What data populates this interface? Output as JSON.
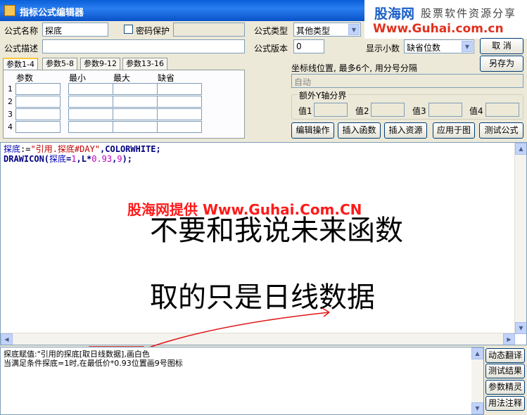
{
  "window": {
    "title": "指标公式编辑器"
  },
  "watermark": {
    "brand": "股海网",
    "tagline": "股票软件资源分享",
    "url": "Www.Guhai.com.cn"
  },
  "form": {
    "name_label": "公式名称",
    "name_value": "探底",
    "password_label": "密码保护",
    "type_label": "公式类型",
    "type_value": "其他类型",
    "desc_label": "公式描述",
    "version_label": "公式版本",
    "version_value": "0",
    "decimals_label": "显示小数",
    "decimals_value": "缺省位数"
  },
  "buttons": {
    "cancel": "取  消",
    "save_as": "另存为",
    "edit_ops": "编辑操作",
    "insert_func": "插入函数",
    "insert_res": "插入资源",
    "apply_chart": "应用于图",
    "test_formula": "测试公式"
  },
  "param_tabs": [
    "参数1-4",
    "参数5-8",
    "参数9-12",
    "参数13-16"
  ],
  "param_headers": [
    "参数",
    "最小",
    "最大",
    "缺省"
  ],
  "param_rows": [
    "1",
    "2",
    "3",
    "4"
  ],
  "axis": {
    "label": "坐标线位置, 最多6个, 用分号分隔",
    "value": "自动",
    "extra_label": "额外Y轴分界",
    "values": [
      "值1",
      "值2",
      "值3",
      "值4"
    ]
  },
  "code": {
    "line1": {
      "var": "探底",
      "op": ":=",
      "str": "\"引用.探底#DAY\"",
      "rest": ",COLORWHITE;"
    },
    "line2": {
      "fn": "DRAWICON(",
      "var": "探底",
      "eq": "=",
      "one": "1",
      "rest1": ",L*",
      "num": "0.93",
      "comma": ",",
      "nine": "9",
      "end": ");"
    }
  },
  "overlay": {
    "red_text": "股海网提供 Www.Guhai.Com.CN",
    "big_line1": "不要和我说未来函数",
    "big_line2": "取的只是日线数据"
  },
  "description": {
    "line1a": "探底赋值:\"引用的探底",
    "line1b": "[取日线数据]",
    "line1c": ",画白色",
    "line2": "当满足条件探底=1时,在最低价*0.93位置画9号图标"
  },
  "side_buttons": [
    "动态翻译",
    "测试结果",
    "参数精灵",
    "用法注释"
  ],
  "colors": {
    "title_bar": "#0a5fd8",
    "overlay_red": "#ff1a1a",
    "arrow_red": "#e01818"
  }
}
